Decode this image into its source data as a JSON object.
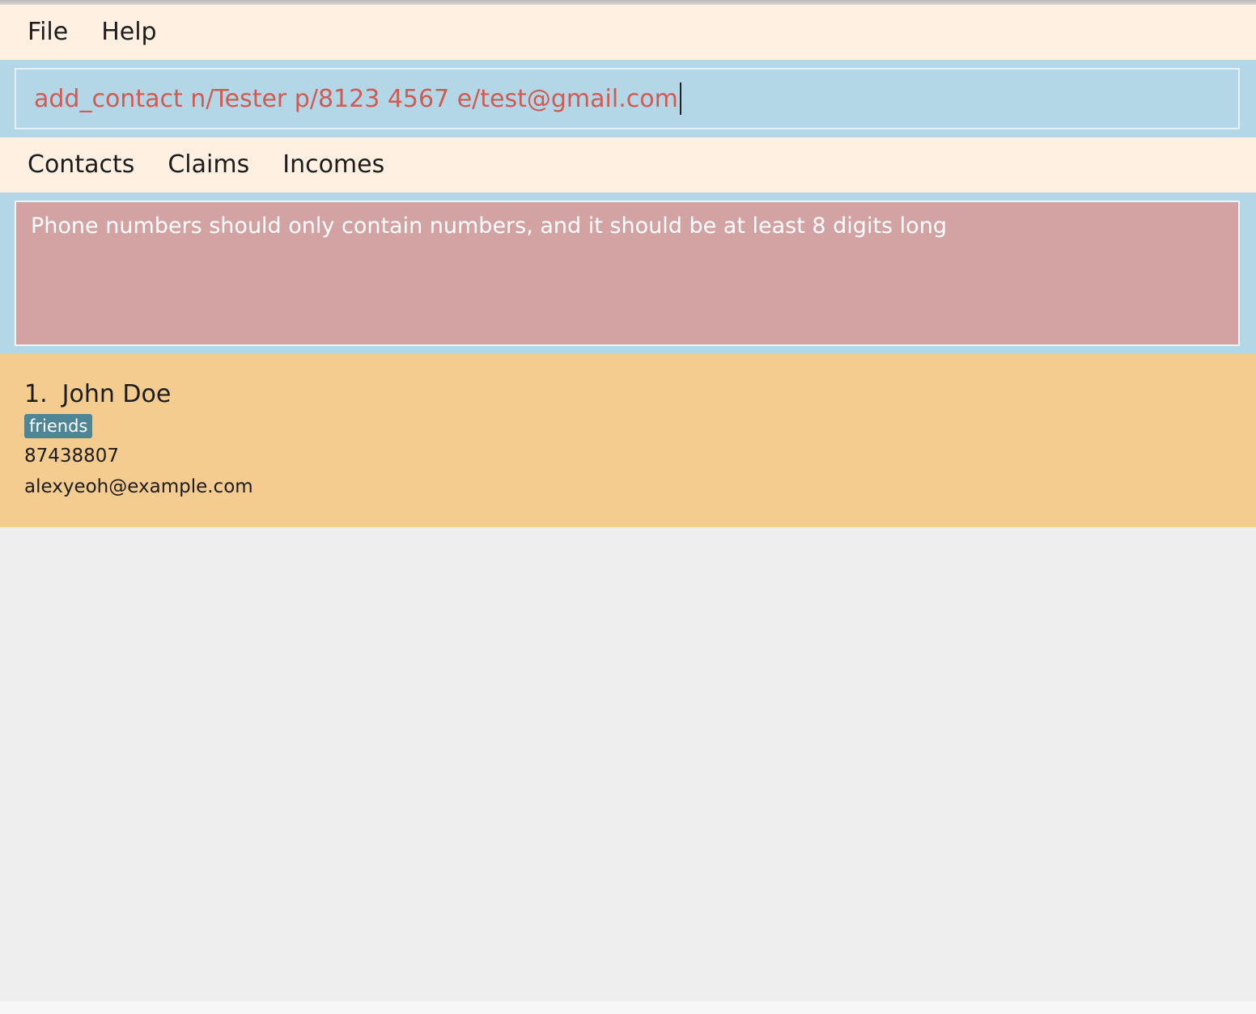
{
  "menu": {
    "items": [
      {
        "label": "File"
      },
      {
        "label": "Help"
      }
    ]
  },
  "command": {
    "value": "add_contact n/Tester p/8123 4567 e/test@gmail.com"
  },
  "tabs": [
    {
      "label": "Contacts"
    },
    {
      "label": "Claims"
    },
    {
      "label": "Incomes"
    }
  ],
  "result": {
    "message": "Phone numbers should only contain numbers, and it should be at least 8 digits long"
  },
  "contacts": [
    {
      "index": "1.",
      "name": "John Doe",
      "tag": "friends",
      "phone": "87438807",
      "email": "alexyeoh@example.com"
    }
  ],
  "colors": {
    "menu_background": "#fff0e2",
    "command_area": "#b3d7e7",
    "command_text": "#cf5b52",
    "error_box": "#d3a3a4",
    "contact_card": "#f4cc90",
    "tag_background": "#4f8696"
  }
}
